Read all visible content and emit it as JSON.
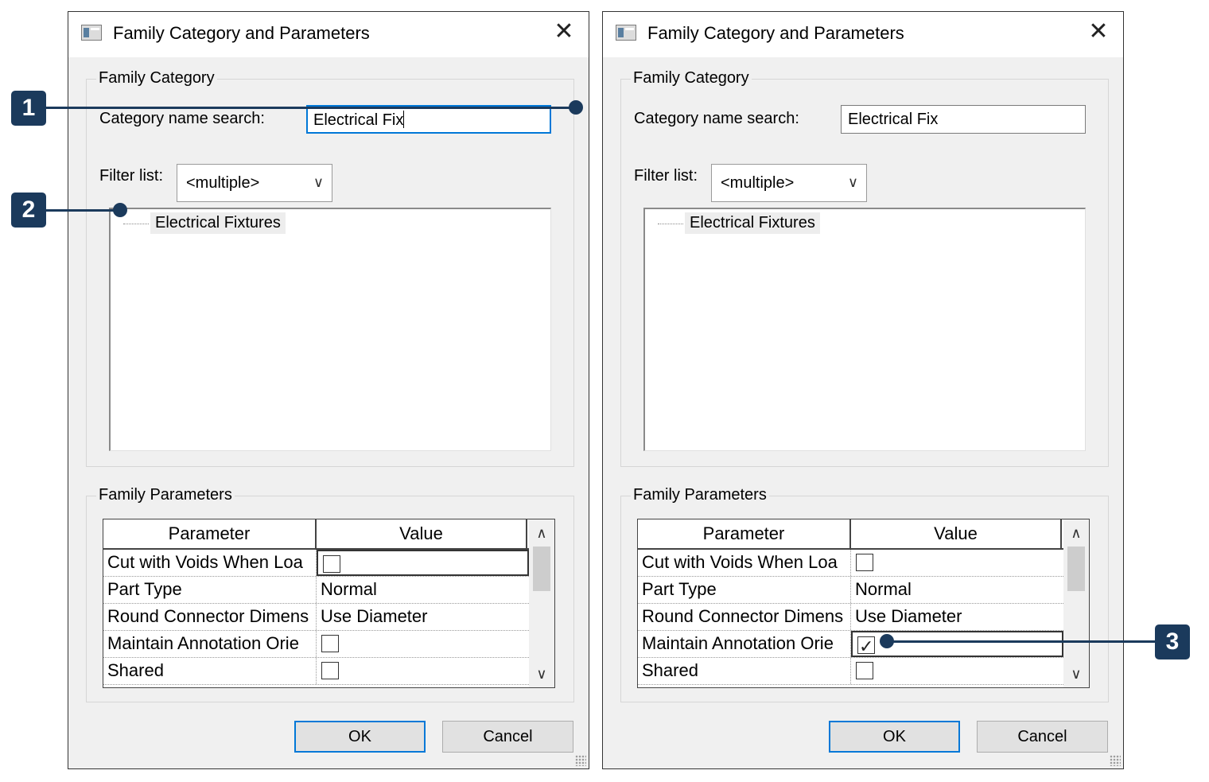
{
  "dialogs": [
    {
      "title": "Family Category and Parameters",
      "family_category": {
        "group_label": "Family Category",
        "search_label": "Category name search:",
        "search_value": "Electrical Fix",
        "filter_label": "Filter list:",
        "filter_value": "<multiple>",
        "list_items": [
          "Electrical Fixtures"
        ]
      },
      "family_parameters": {
        "group_label": "Family Parameters",
        "columns": [
          "Parameter",
          "Value"
        ],
        "rows": [
          {
            "parameter": "Cut with Voids When Loa",
            "type": "checkbox",
            "checked": false
          },
          {
            "parameter": "Part Type",
            "type": "text",
            "value": "Normal"
          },
          {
            "parameter": "Round Connector Dimens",
            "type": "text",
            "value": "Use Diameter"
          },
          {
            "parameter": "Maintain Annotation Orie",
            "type": "checkbox",
            "checked": false
          },
          {
            "parameter": "Shared",
            "type": "checkbox",
            "checked": false
          }
        ]
      },
      "buttons": {
        "ok": "OK",
        "cancel": "Cancel"
      }
    },
    {
      "title": "Family Category and Parameters",
      "family_category": {
        "group_label": "Family Category",
        "search_label": "Category name search:",
        "search_value": "Electrical Fix",
        "filter_label": "Filter list:",
        "filter_value": "<multiple>",
        "list_items": [
          "Electrical Fixtures"
        ]
      },
      "family_parameters": {
        "group_label": "Family Parameters",
        "columns": [
          "Parameter",
          "Value"
        ],
        "rows": [
          {
            "parameter": "Cut with Voids When Loa",
            "type": "checkbox",
            "checked": false
          },
          {
            "parameter": "Part Type",
            "type": "text",
            "value": "Normal"
          },
          {
            "parameter": "Round Connector Dimens",
            "type": "text",
            "value": "Use Diameter"
          },
          {
            "parameter": "Maintain Annotation Orie",
            "type": "checkbox",
            "checked": true
          },
          {
            "parameter": "Shared",
            "type": "checkbox",
            "checked": false
          }
        ]
      },
      "buttons": {
        "ok": "OK",
        "cancel": "Cancel"
      }
    }
  ],
  "callouts": [
    "1",
    "2",
    "3"
  ],
  "colors": {
    "callout": "#1b3a5c",
    "focus": "#0078d7",
    "dialog_bg": "#f0f0f0"
  }
}
